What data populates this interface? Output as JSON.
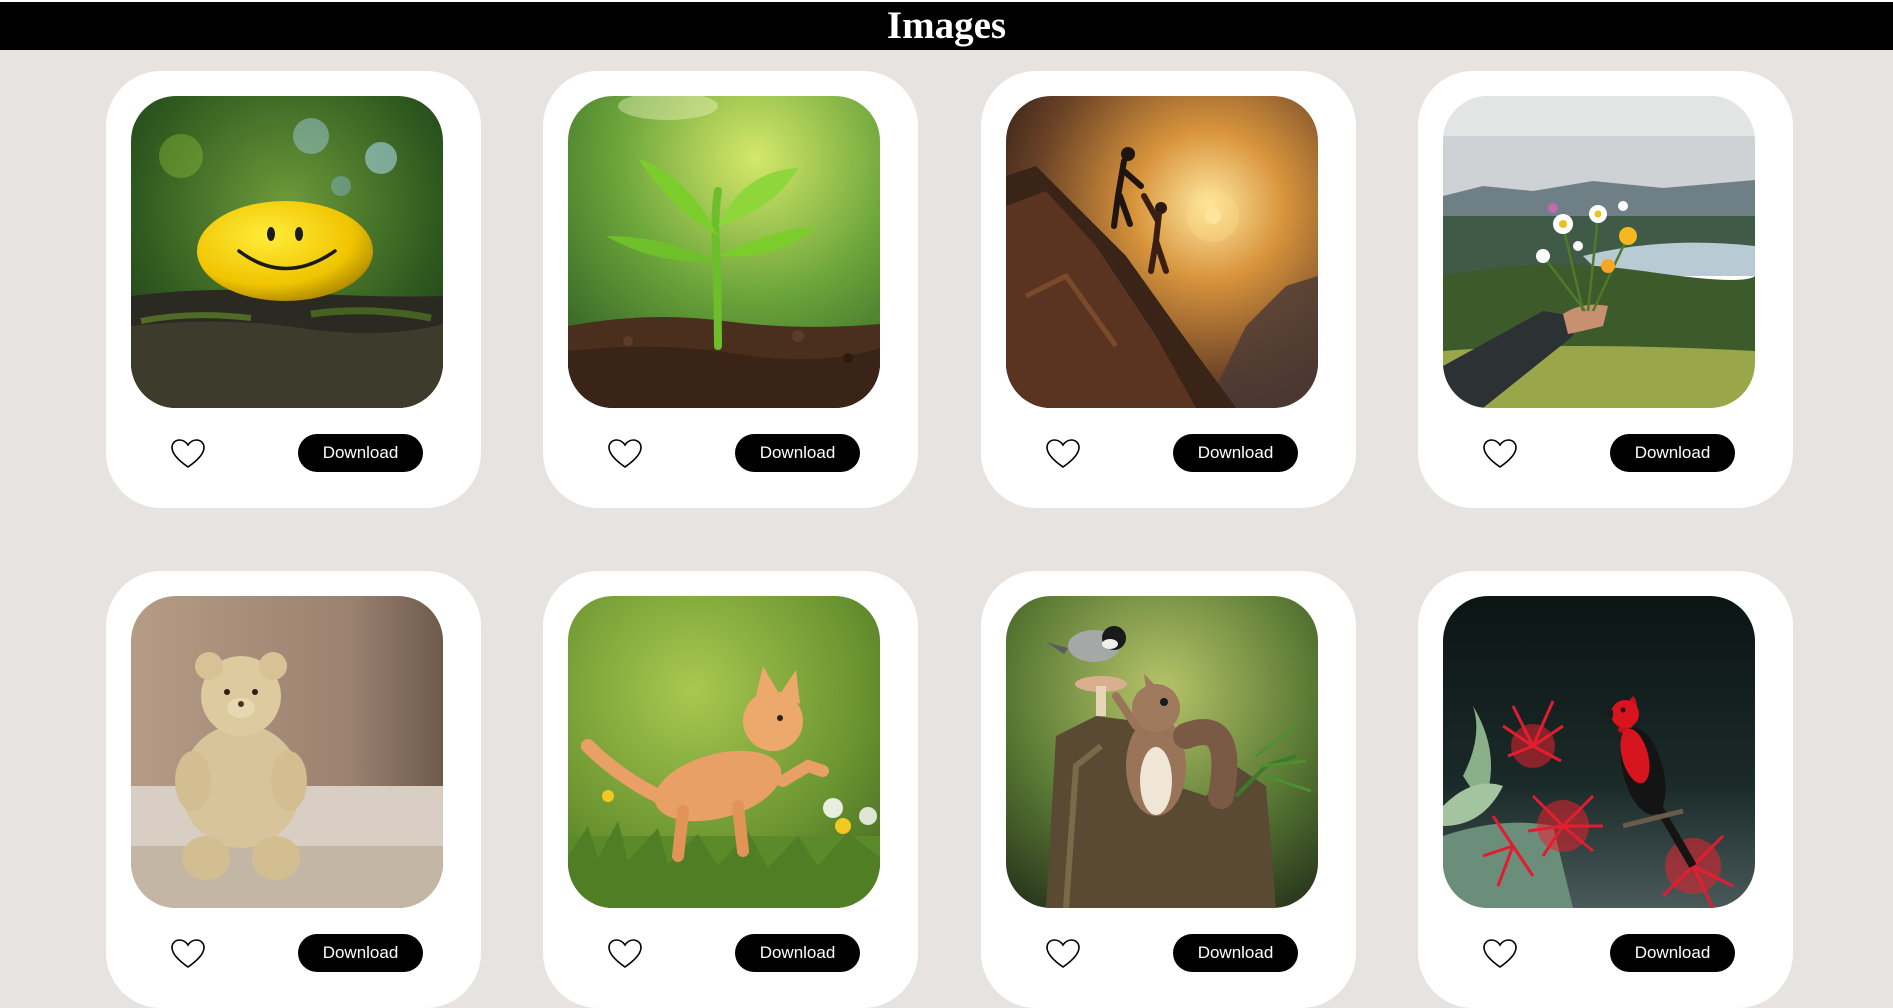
{
  "header": {
    "title": "Images"
  },
  "cards": [
    {
      "subject": "yellow smiley ball on mossy rock",
      "download_label": "Download"
    },
    {
      "subject": "green seedling sprouting from soil",
      "download_label": "Download"
    },
    {
      "subject": "two climbers helping each other at sunset",
      "download_label": "Download"
    },
    {
      "subject": "hand holding wildflowers over lake valley",
      "download_label": "Download"
    },
    {
      "subject": "beige teddy bear sitting on carpet",
      "download_label": "Download"
    },
    {
      "subject": "orange kitten playing in grass",
      "download_label": "Download"
    },
    {
      "subject": "squirrel and chickadee on tree stump",
      "download_label": "Download"
    },
    {
      "subject": "red bird on red flowering branch",
      "download_label": "Download"
    }
  ],
  "colors": {
    "header_bg": "#000000",
    "page_bg": "#e6e3e1",
    "card_bg": "#ffffff",
    "button_bg": "#000000",
    "button_text": "#ffffff"
  },
  "icons": {
    "like": "heart-outline-icon"
  }
}
